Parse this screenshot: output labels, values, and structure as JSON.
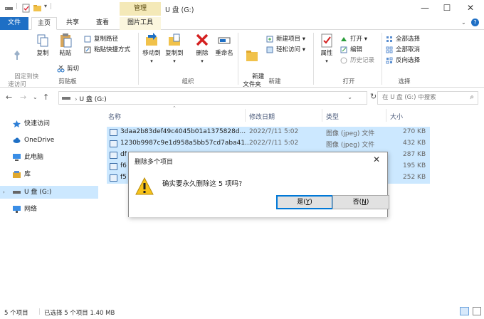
{
  "window": {
    "title": "U 盘 (G:)",
    "context_tab": "管理"
  },
  "tabs": [
    {
      "label": "文件"
    },
    {
      "label": "主页"
    },
    {
      "label": "共享"
    },
    {
      "label": "查看"
    },
    {
      "label": "图片工具"
    }
  ],
  "ribbon": {
    "clipboard": {
      "pin_quick_access": "固定到快\n速访问",
      "copy": "复制",
      "paste": "粘贴",
      "copy_path": "复制路径",
      "paste_shortcut": "粘贴快捷方式",
      "cut": "剪切",
      "label": "剪贴板"
    },
    "organize": {
      "move_to": "移动到",
      "copy_to": "复制到",
      "delete": "删除",
      "rename": "重命名",
      "label": "组织"
    },
    "new": {
      "new_folder": "新建\n文件夹",
      "new_item": "新建项目",
      "easy_access": "轻松访问",
      "label": "新建"
    },
    "open": {
      "properties": "属性",
      "open": "打开",
      "edit": "编辑",
      "history": "历史记录",
      "label": "打开"
    },
    "select": {
      "select_all": "全部选择",
      "select_none": "全部取消",
      "invert": "反向选择",
      "label": "选择"
    }
  },
  "address": {
    "path": "U 盘 (G:)",
    "search_placeholder": "在 U 盘 (G:) 中搜索"
  },
  "nav": {
    "items": [
      {
        "label": "快速访问"
      },
      {
        "label": "OneDrive"
      },
      {
        "label": "此电脑"
      },
      {
        "label": "库"
      },
      {
        "label": "U 盘 (G:)"
      },
      {
        "label": "网络"
      }
    ]
  },
  "columns": {
    "name": "名称",
    "date": "修改日期",
    "type": "类型",
    "size": "大小"
  },
  "files": [
    {
      "name": "3daa2b83def49c4045b01a1375828d...",
      "date": "2022/7/11 5:02",
      "type": "图像 (jpeg) 文件",
      "size": "270 KB"
    },
    {
      "name": "1230b9987c9e1d958a5bb57cd7aba41...",
      "date": "2022/7/11 5:02",
      "type": "图像 (jpeg) 文件",
      "size": "432 KB"
    },
    {
      "name": "df",
      "date": "",
      "type": "",
      "size": "287 KB"
    },
    {
      "name": "f6",
      "date": "",
      "type": "",
      "size": "195 KB"
    },
    {
      "name": "f5",
      "date": "",
      "type": "",
      "size": "252 KB"
    }
  ],
  "status": {
    "count": "5 个项目",
    "selected": "已选择 5 个项目  1.40 MB"
  },
  "dialog": {
    "title": "删除多个项目",
    "message": "确实要永久删除这 5 项吗?",
    "yes_label": "是",
    "yes_key": "Y",
    "no_label": "否",
    "no_key": "N"
  },
  "colors": {
    "accent": "#1e6fc5",
    "selection": "#cce8ff",
    "context_tab": "#f4e9b8"
  }
}
